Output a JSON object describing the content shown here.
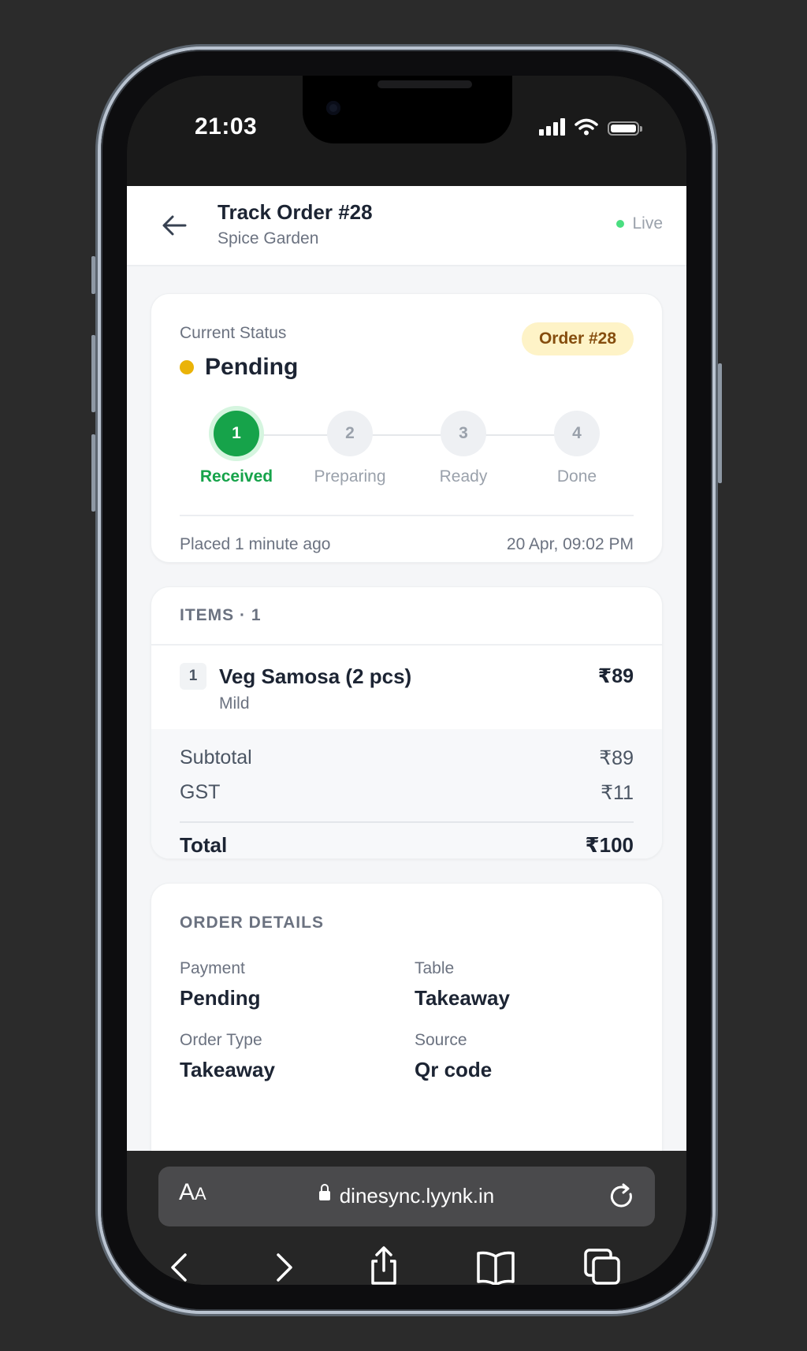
{
  "status_bar": {
    "time": "21:03"
  },
  "header": {
    "title": "Track Order #28",
    "subtitle": "Spice Garden",
    "live_label": "Live"
  },
  "status_card": {
    "label": "Current Status",
    "status": "Pending",
    "badge": "Order #28",
    "steps": [
      {
        "number": "1",
        "label": "Received",
        "active": true
      },
      {
        "number": "2",
        "label": "Preparing",
        "active": false
      },
      {
        "number": "3",
        "label": "Ready",
        "active": false
      },
      {
        "number": "4",
        "label": "Done",
        "active": false
      }
    ],
    "placed": "Placed 1 minute ago",
    "timestamp": "20 Apr, 09:02 PM"
  },
  "items_card": {
    "heading": "ITEMS · 1",
    "items": [
      {
        "qty": "1",
        "name": "Veg Samosa (2 pcs)",
        "note": "Mild",
        "price": "₹89"
      }
    ],
    "subtotal_label": "Subtotal",
    "subtotal": "₹89",
    "gst_label": "GST",
    "gst": "₹11",
    "total_label": "Total",
    "total": "₹100"
  },
  "order_details": {
    "heading": "ORDER DETAILS",
    "payment_label": "Payment",
    "payment": "Pending",
    "table_label": "Table",
    "table": "Takeaway",
    "type_label": "Order Type",
    "type": "Takeaway",
    "source_label": "Source",
    "source": "Qr code"
  },
  "browser": {
    "aa_large": "A",
    "aa_small": "A",
    "url": "dinesync.lyynk.in"
  },
  "colors": {
    "accent_green": "#16a34a",
    "pending_yellow": "#eab308",
    "badge_bg": "#fef3c7",
    "live_dot": "#4ade80"
  }
}
